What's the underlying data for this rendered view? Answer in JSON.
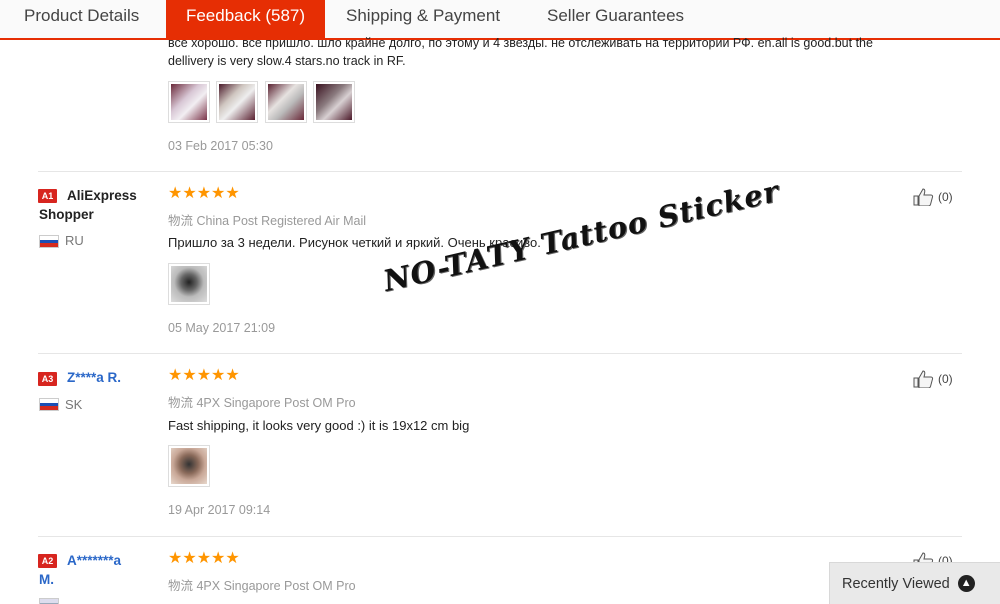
{
  "tabs": [
    {
      "label": "Product Details"
    },
    {
      "label": "Feedback (587)"
    },
    {
      "label": "Shipping & Payment"
    },
    {
      "label": "Seller Guarantees"
    }
  ],
  "prev_review": {
    "text_line1": "все хорошо. все пришло. шло крайне долго, по этому и 4 звезды. не отслеживать на территории РФ. en.all is good.but the",
    "text_line2": "dellivery is very slow.4 stars.no track in RF.",
    "date": "03 Feb 2017 05:30"
  },
  "reviews": [
    {
      "badge": "A1",
      "name_line1": "AliExpress",
      "name_line2": "Shopper",
      "country": "RU",
      "stars": "★★★★★",
      "shipping": "物流 China Post Registered Air Mail",
      "text": "Пришло за 3 недели. Рисунок четкий и яркий. Очень красиво.",
      "date": "05 May 2017 21:09",
      "likes": "(0)"
    },
    {
      "badge": "A3",
      "name_line1": "Z****a R.",
      "country": "SK",
      "stars": "★★★★★",
      "shipping": "物流 4PX Singapore Post OM Pro",
      "text": "Fast shipping, it looks very good :) it is 19x12 cm big",
      "date": "19 Apr 2017 09:14",
      "likes": "(0)"
    },
    {
      "badge": "A2",
      "name_line1": "A*******a",
      "name_line2": "M.",
      "stars": "★★★★★",
      "shipping": "物流 4PX Singapore Post OM Pro",
      "likes": "(0)"
    }
  ],
  "watermark": "NO-TATY Tattoo Sticker",
  "recently_viewed": "Recently Viewed",
  "colors": {
    "accent": "#e62e04",
    "star": "#ff9500",
    "badge": "#d7251f",
    "name_blue": "#2a67c8"
  }
}
